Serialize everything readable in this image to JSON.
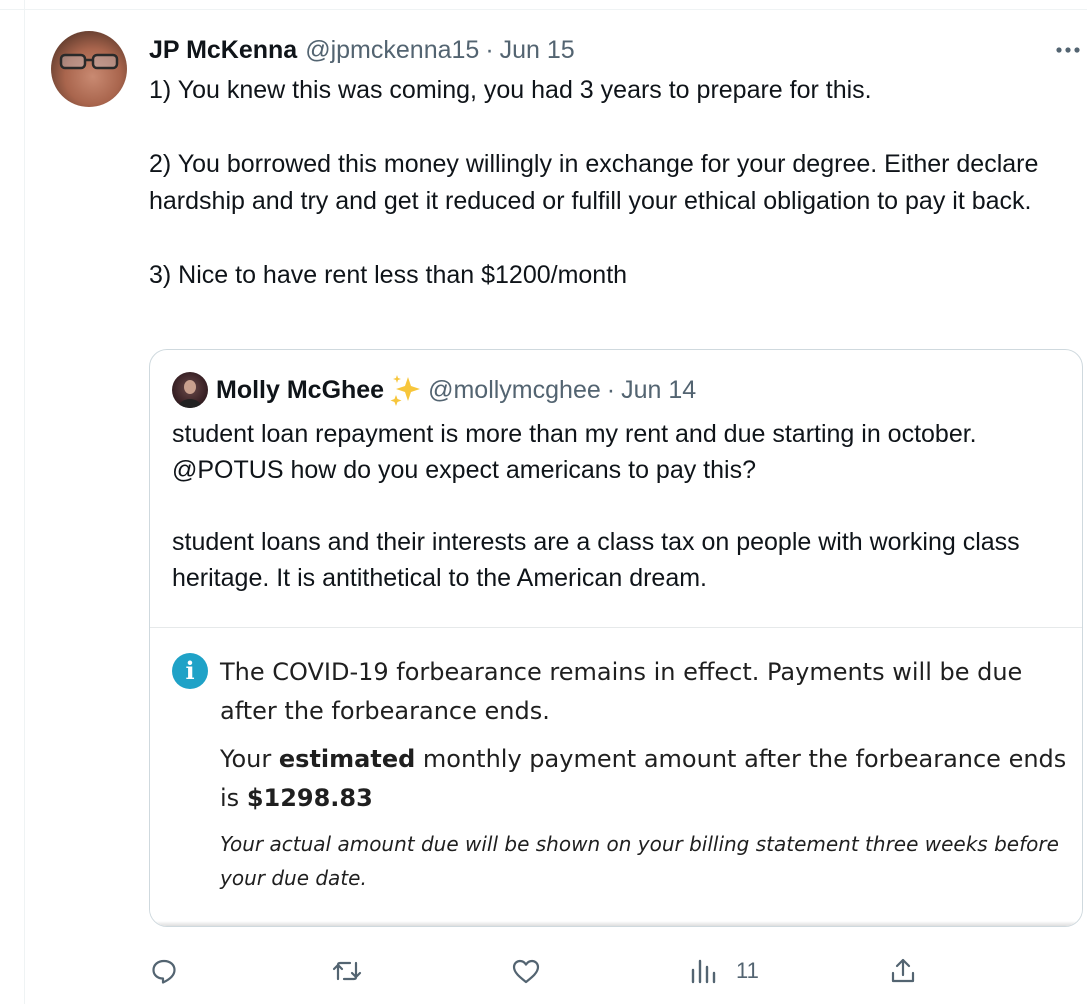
{
  "tweet": {
    "author_name": "JP McKenna",
    "handle": "@jpmckenna15",
    "separator": "·",
    "date": "Jun 15",
    "more_icon": "more-icon",
    "paragraphs": [
      "1) You knew this was coming, you had 3 years to prepare for this.",
      "2) You borrowed this money willingly in exchange for your degree. Either declare hardship and try and get it reduced or fulfill your ethical obligation to pay it back.",
      "3) Nice to have rent less than $1200/month"
    ]
  },
  "quote": {
    "author_name": "Molly McGhee",
    "badge_icon": "sparkles-icon",
    "handle": "@mollymcghee",
    "separator": "·",
    "date": "Jun 14",
    "paragraphs": [
      "student loan repayment is more than my rent and due starting in october. @POTUS how do you expect americans to pay this?",
      "student loans and their interests are a class tax on people with working class heritage. It is antithetical to the American dream."
    ],
    "media": {
      "info_icon": "info-icon",
      "info_glyph": "i",
      "line1": "The COVID-19 forbearance remains in effect. Payments will be due after the forbearance ends.",
      "line2_prefix": "Your ",
      "line2_bold": "estimated",
      "line2_mid": " monthly payment amount after the forbearance ends is ",
      "line2_amount": "$1298.83",
      "line3": "Your actual amount due will be shown on your billing statement three weeks before your due date.",
      "accent_color": "#1fa2c7"
    }
  },
  "actions": {
    "reply_icon": "reply-icon",
    "retweet_icon": "retweet-icon",
    "like_icon": "like-icon",
    "views_icon": "views-icon",
    "views_count": "11",
    "share_icon": "share-icon"
  }
}
